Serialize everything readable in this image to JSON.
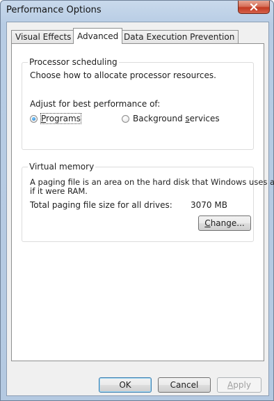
{
  "window": {
    "title": "Performance Options"
  },
  "tabs": [
    {
      "label": "Visual Effects",
      "active": false
    },
    {
      "label": "Advanced",
      "active": true
    },
    {
      "label": "Data Execution Prevention",
      "active": false
    }
  ],
  "processor": {
    "group_label": "Processor scheduling",
    "description": "Choose how to allocate processor resources.",
    "adjust_label": "Adjust for best performance of:",
    "options": [
      {
        "label_pre": "",
        "label_hotkey": "P",
        "label_post": "rograms",
        "selected": true
      },
      {
        "label_pre": "Background ",
        "label_hotkey": "s",
        "label_post": "ervices",
        "selected": false
      }
    ]
  },
  "virtual_memory": {
    "group_label": "Virtual memory",
    "description_line1": "A paging file is an area on the hard disk that Windows uses as",
    "description_line2": "if it were RAM.",
    "total_label": "Total paging file size for all drives:",
    "total_value": "3070 MB",
    "change_button": {
      "pre": "",
      "hotkey": "C",
      "post": "hange..."
    }
  },
  "buttons": {
    "ok": "OK",
    "cancel": "Cancel",
    "apply": {
      "pre": "",
      "hotkey": "A",
      "post": "pply"
    }
  },
  "icons": {
    "close": "close-x-icon",
    "radio": "radio-button-icon"
  },
  "colors": {
    "close_button": "#c23a22",
    "radio_dot": "#1a6fc4",
    "default_button_border": "#3c7fb1"
  }
}
